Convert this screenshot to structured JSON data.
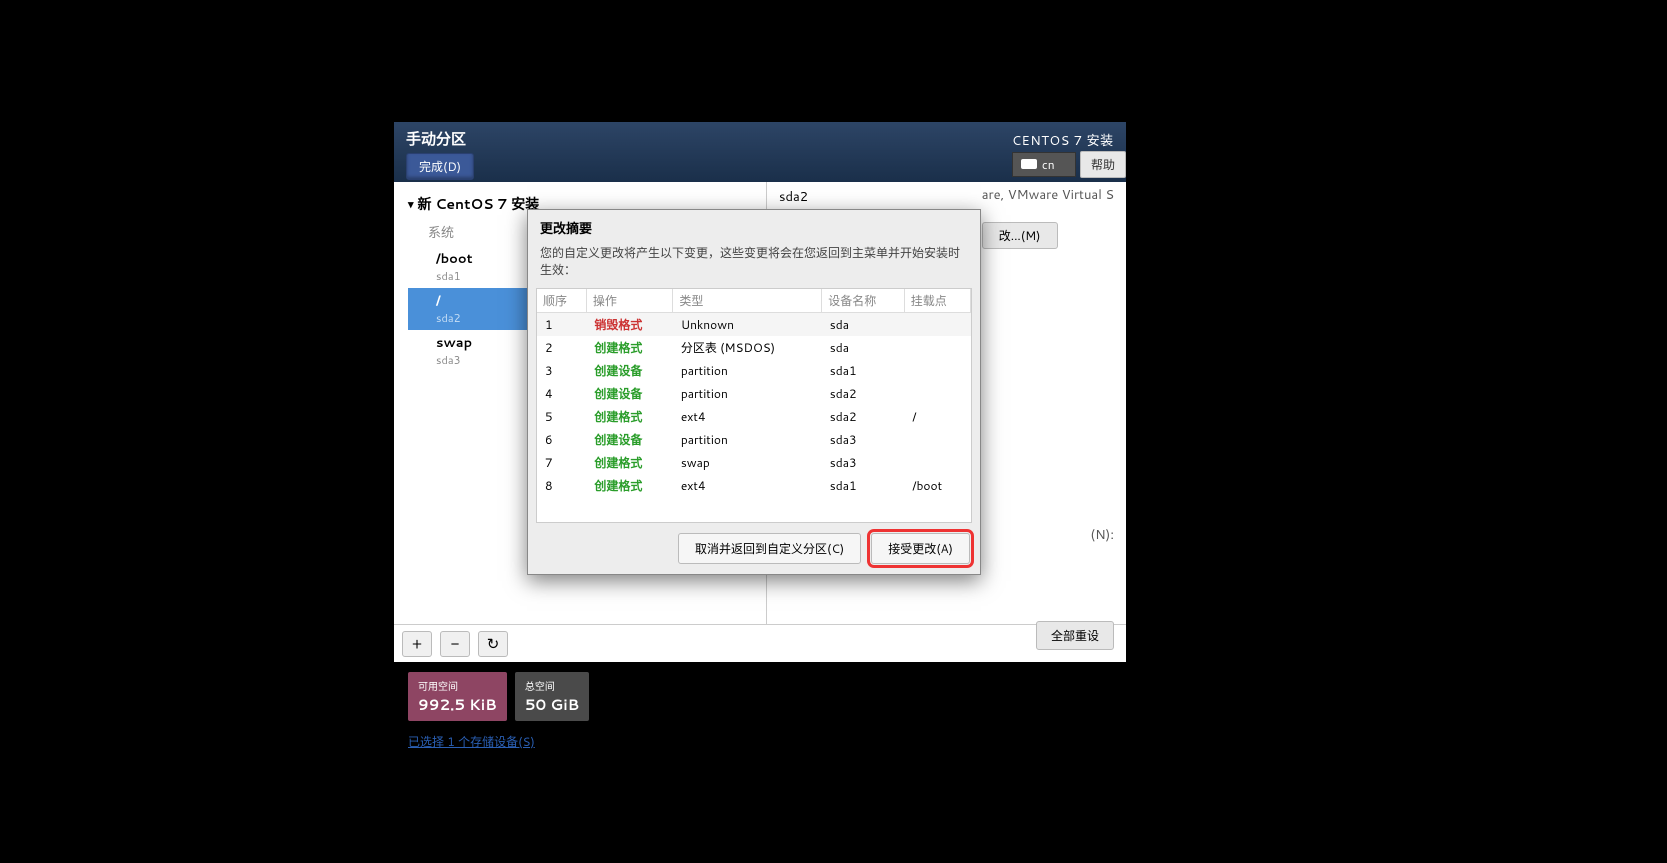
{
  "header": {
    "title": "手动分区",
    "done_label": "完成(D)",
    "install_label": "CENTOS 7 安装",
    "lang": "cn",
    "help_label": "帮助"
  },
  "sidebar": {
    "tree_title": "新 CentOS 7 安装",
    "group_label": "系统",
    "items": [
      {
        "label": "/boot",
        "dev": "sda1",
        "selected": false
      },
      {
        "label": "/",
        "dev": "sda2",
        "selected": true
      },
      {
        "label": "swap",
        "dev": "sda3",
        "selected": false
      }
    ]
  },
  "right": {
    "section_title": "sda2",
    "device_text": "are, VMware Virtual S",
    "modify_label": "改...(M)",
    "hint_n": "(N):"
  },
  "toolbar": {
    "plus": "+",
    "minus": "−",
    "refresh": "↻"
  },
  "footer": {
    "avail_label": "可用空间",
    "avail_value": "992.5 KiB",
    "total_label": "总空间",
    "total_value": "50 GiB",
    "storage_link": "已选择 1 个存储设备(S)",
    "reset_label": "全部重设"
  },
  "dialog": {
    "title": "更改摘要",
    "subtitle": "您的自定义更改将产生以下变更，这些变更将会在您返回到主菜单并开始安装时生效：",
    "columns": {
      "seq": "顺序",
      "op": "操作",
      "type": "类型",
      "dev": "设备名称",
      "mount": "挂载点"
    },
    "rows": [
      {
        "seq": "1",
        "op": "销毁格式",
        "op_class": "destroy",
        "type": "Unknown",
        "dev": "sda",
        "mount": ""
      },
      {
        "seq": "2",
        "op": "创建格式",
        "op_class": "create",
        "type": "分区表 (MSDOS)",
        "dev": "sda",
        "mount": ""
      },
      {
        "seq": "3",
        "op": "创建设备",
        "op_class": "create",
        "type": "partition",
        "dev": "sda1",
        "mount": ""
      },
      {
        "seq": "4",
        "op": "创建设备",
        "op_class": "create",
        "type": "partition",
        "dev": "sda2",
        "mount": ""
      },
      {
        "seq": "5",
        "op": "创建格式",
        "op_class": "create",
        "type": "ext4",
        "dev": "sda2",
        "mount": "/"
      },
      {
        "seq": "6",
        "op": "创建设备",
        "op_class": "create",
        "type": "partition",
        "dev": "sda3",
        "mount": ""
      },
      {
        "seq": "7",
        "op": "创建格式",
        "op_class": "create",
        "type": "swap",
        "dev": "sda3",
        "mount": ""
      },
      {
        "seq": "8",
        "op": "创建格式",
        "op_class": "create",
        "type": "ext4",
        "dev": "sda1",
        "mount": "/boot"
      }
    ],
    "cancel_label": "取消并返回到自定义分区(C)",
    "accept_label": "接受更改(A)"
  }
}
